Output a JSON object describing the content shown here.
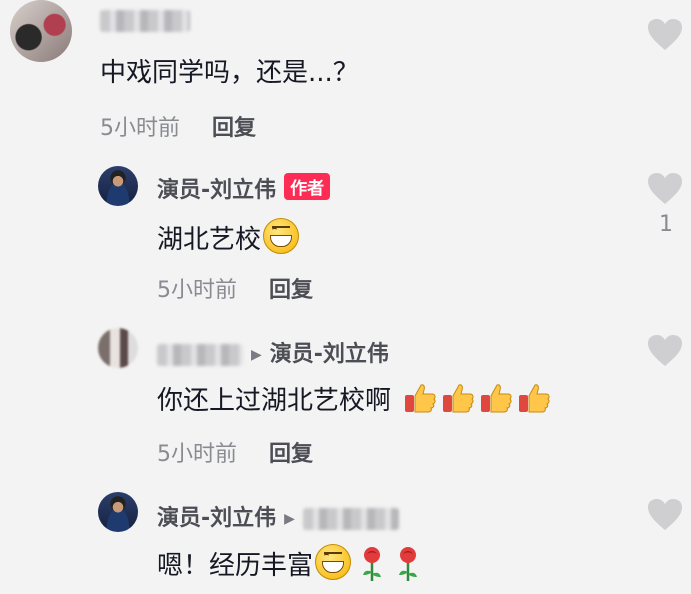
{
  "comments": [
    {
      "author": "",
      "text": "中戏同学吗，还是...？",
      "time": "5小时前",
      "reply_label": "回复",
      "likes": ""
    },
    {
      "author": "演员-刘立伟",
      "author_tag": "作者",
      "text": "湖北艺校",
      "time": "5小时前",
      "reply_label": "回复",
      "likes": "1"
    },
    {
      "author": "",
      "reply_to": "演员-刘立伟",
      "text": "你还上过湖北艺校啊",
      "time": "5小时前",
      "reply_label": "回复",
      "likes": ""
    },
    {
      "author": "演员-刘立伟",
      "reply_to": "",
      "text": "嗯！经历丰富",
      "likes": ""
    }
  ],
  "icons": {
    "like": "heart-icon",
    "reply_arrow": "triangle-right-icon",
    "emoji_grin": "grinning-face-emoji",
    "emoji_thumb": "thumbs-up-emoji",
    "emoji_rose": "rose-emoji"
  },
  "colors": {
    "author_tag_bg": "#fe2c55",
    "heart": "#cfcfd1",
    "background": "#f3f3f3"
  }
}
